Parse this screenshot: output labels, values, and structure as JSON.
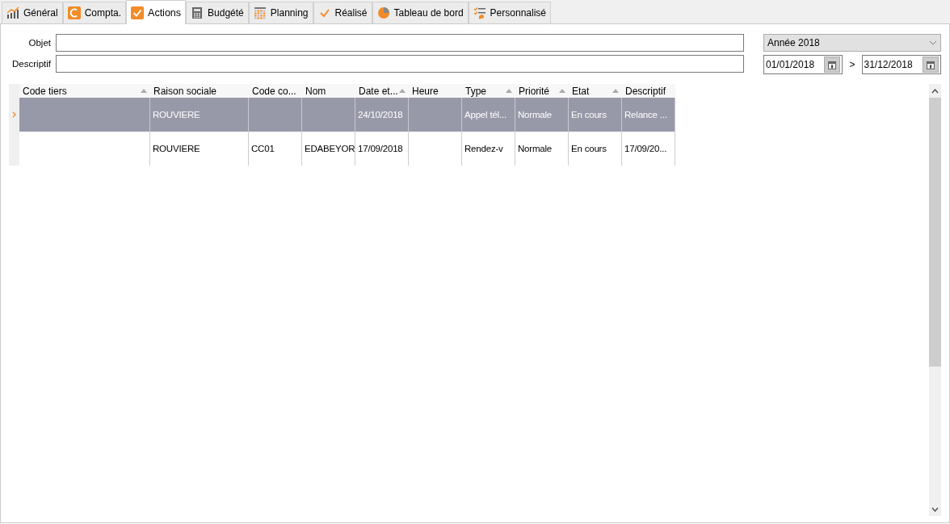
{
  "tabs": [
    {
      "label": "Général",
      "selected": false
    },
    {
      "label": "Compta.",
      "selected": false
    },
    {
      "label": "Actions",
      "selected": true
    },
    {
      "label": "Budgété",
      "selected": false
    },
    {
      "label": "Planning",
      "selected": false
    },
    {
      "label": "Réalisé",
      "selected": false
    },
    {
      "label": "Tableau de bord",
      "selected": false
    },
    {
      "label": "Personnalisé",
      "selected": false
    }
  ],
  "fields": [
    {
      "label": "Objet"
    },
    {
      "label": "Descriptif"
    }
  ],
  "period": {
    "value": "Année 2018",
    "start": "01/01/2018",
    "separator": ">",
    "end": "31/12/2018"
  },
  "table": {
    "columns": [
      {
        "label": "Code tiers",
        "sorted": true
      },
      {
        "label": "Raison sociale",
        "sorted": false
      },
      {
        "label": "Code co...",
        "sorted": false
      },
      {
        "label": "Nom",
        "sorted": false
      },
      {
        "label": "Date et...",
        "sorted": true
      },
      {
        "label": "Heure",
        "sorted": false
      },
      {
        "label": "Type",
        "sorted": true
      },
      {
        "label": "Priorité",
        "sorted": true
      },
      {
        "label": "Etat",
        "sorted": true
      },
      {
        "label": "Descriptif",
        "sorted": false
      }
    ],
    "rows": [
      {
        "selected": true,
        "cells": [
          "",
          "ROUVIERE",
          "",
          "",
          "24/10/2018",
          "",
          "Appel tél...",
          "Normale",
          "En cours",
          "Relance ..."
        ]
      },
      {
        "selected": false,
        "cells": [
          "",
          "ROUVIERE",
          "CC01",
          "EDABEYOR",
          "17/09/2018",
          "",
          "Rendez-v",
          "Normale",
          "En cours",
          "17/09/20..."
        ]
      }
    ]
  }
}
